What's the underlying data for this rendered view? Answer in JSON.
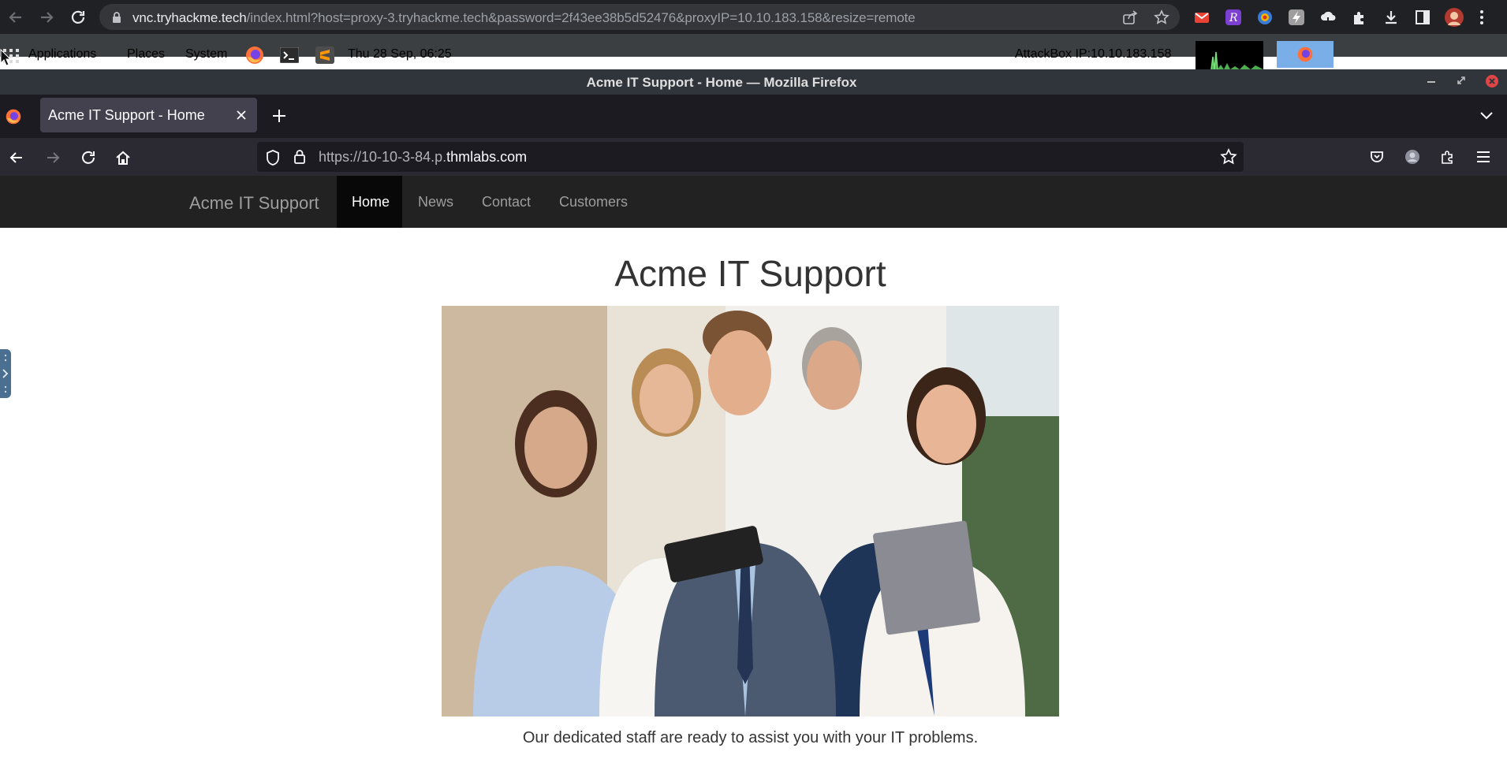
{
  "chrome": {
    "url_host": "vnc.tryhackme.tech",
    "url_rest": "/index.html?host=proxy-3.tryhackme.tech&password=2f43ee38b5d52476&proxyIP=10.10.183.158&resize=remote"
  },
  "desktop_panel": {
    "applications": "Applications",
    "places": "Places",
    "system": "System",
    "datetime": "Thu 28 Sep, 06:25",
    "attackbox_ip": "AttackBox IP:10.10.183.158"
  },
  "firefox": {
    "window_title": "Acme IT Support - Home — Mozilla Firefox",
    "tab_title": "Acme IT Support - Home",
    "url_prefix": "https://10-10-3-84.p.",
    "url_domain": "thmlabs.com"
  },
  "site": {
    "brand": "Acme IT Support",
    "nav": [
      "Home",
      "News",
      "Contact",
      "Customers"
    ],
    "active_nav": "Home",
    "heading": "Acme IT Support",
    "caption": "Our dedicated staff are ready to assist you with your IT problems."
  },
  "colors": {
    "site_navbar": "#222222",
    "firefox_panel_button": "#7aaee8"
  }
}
